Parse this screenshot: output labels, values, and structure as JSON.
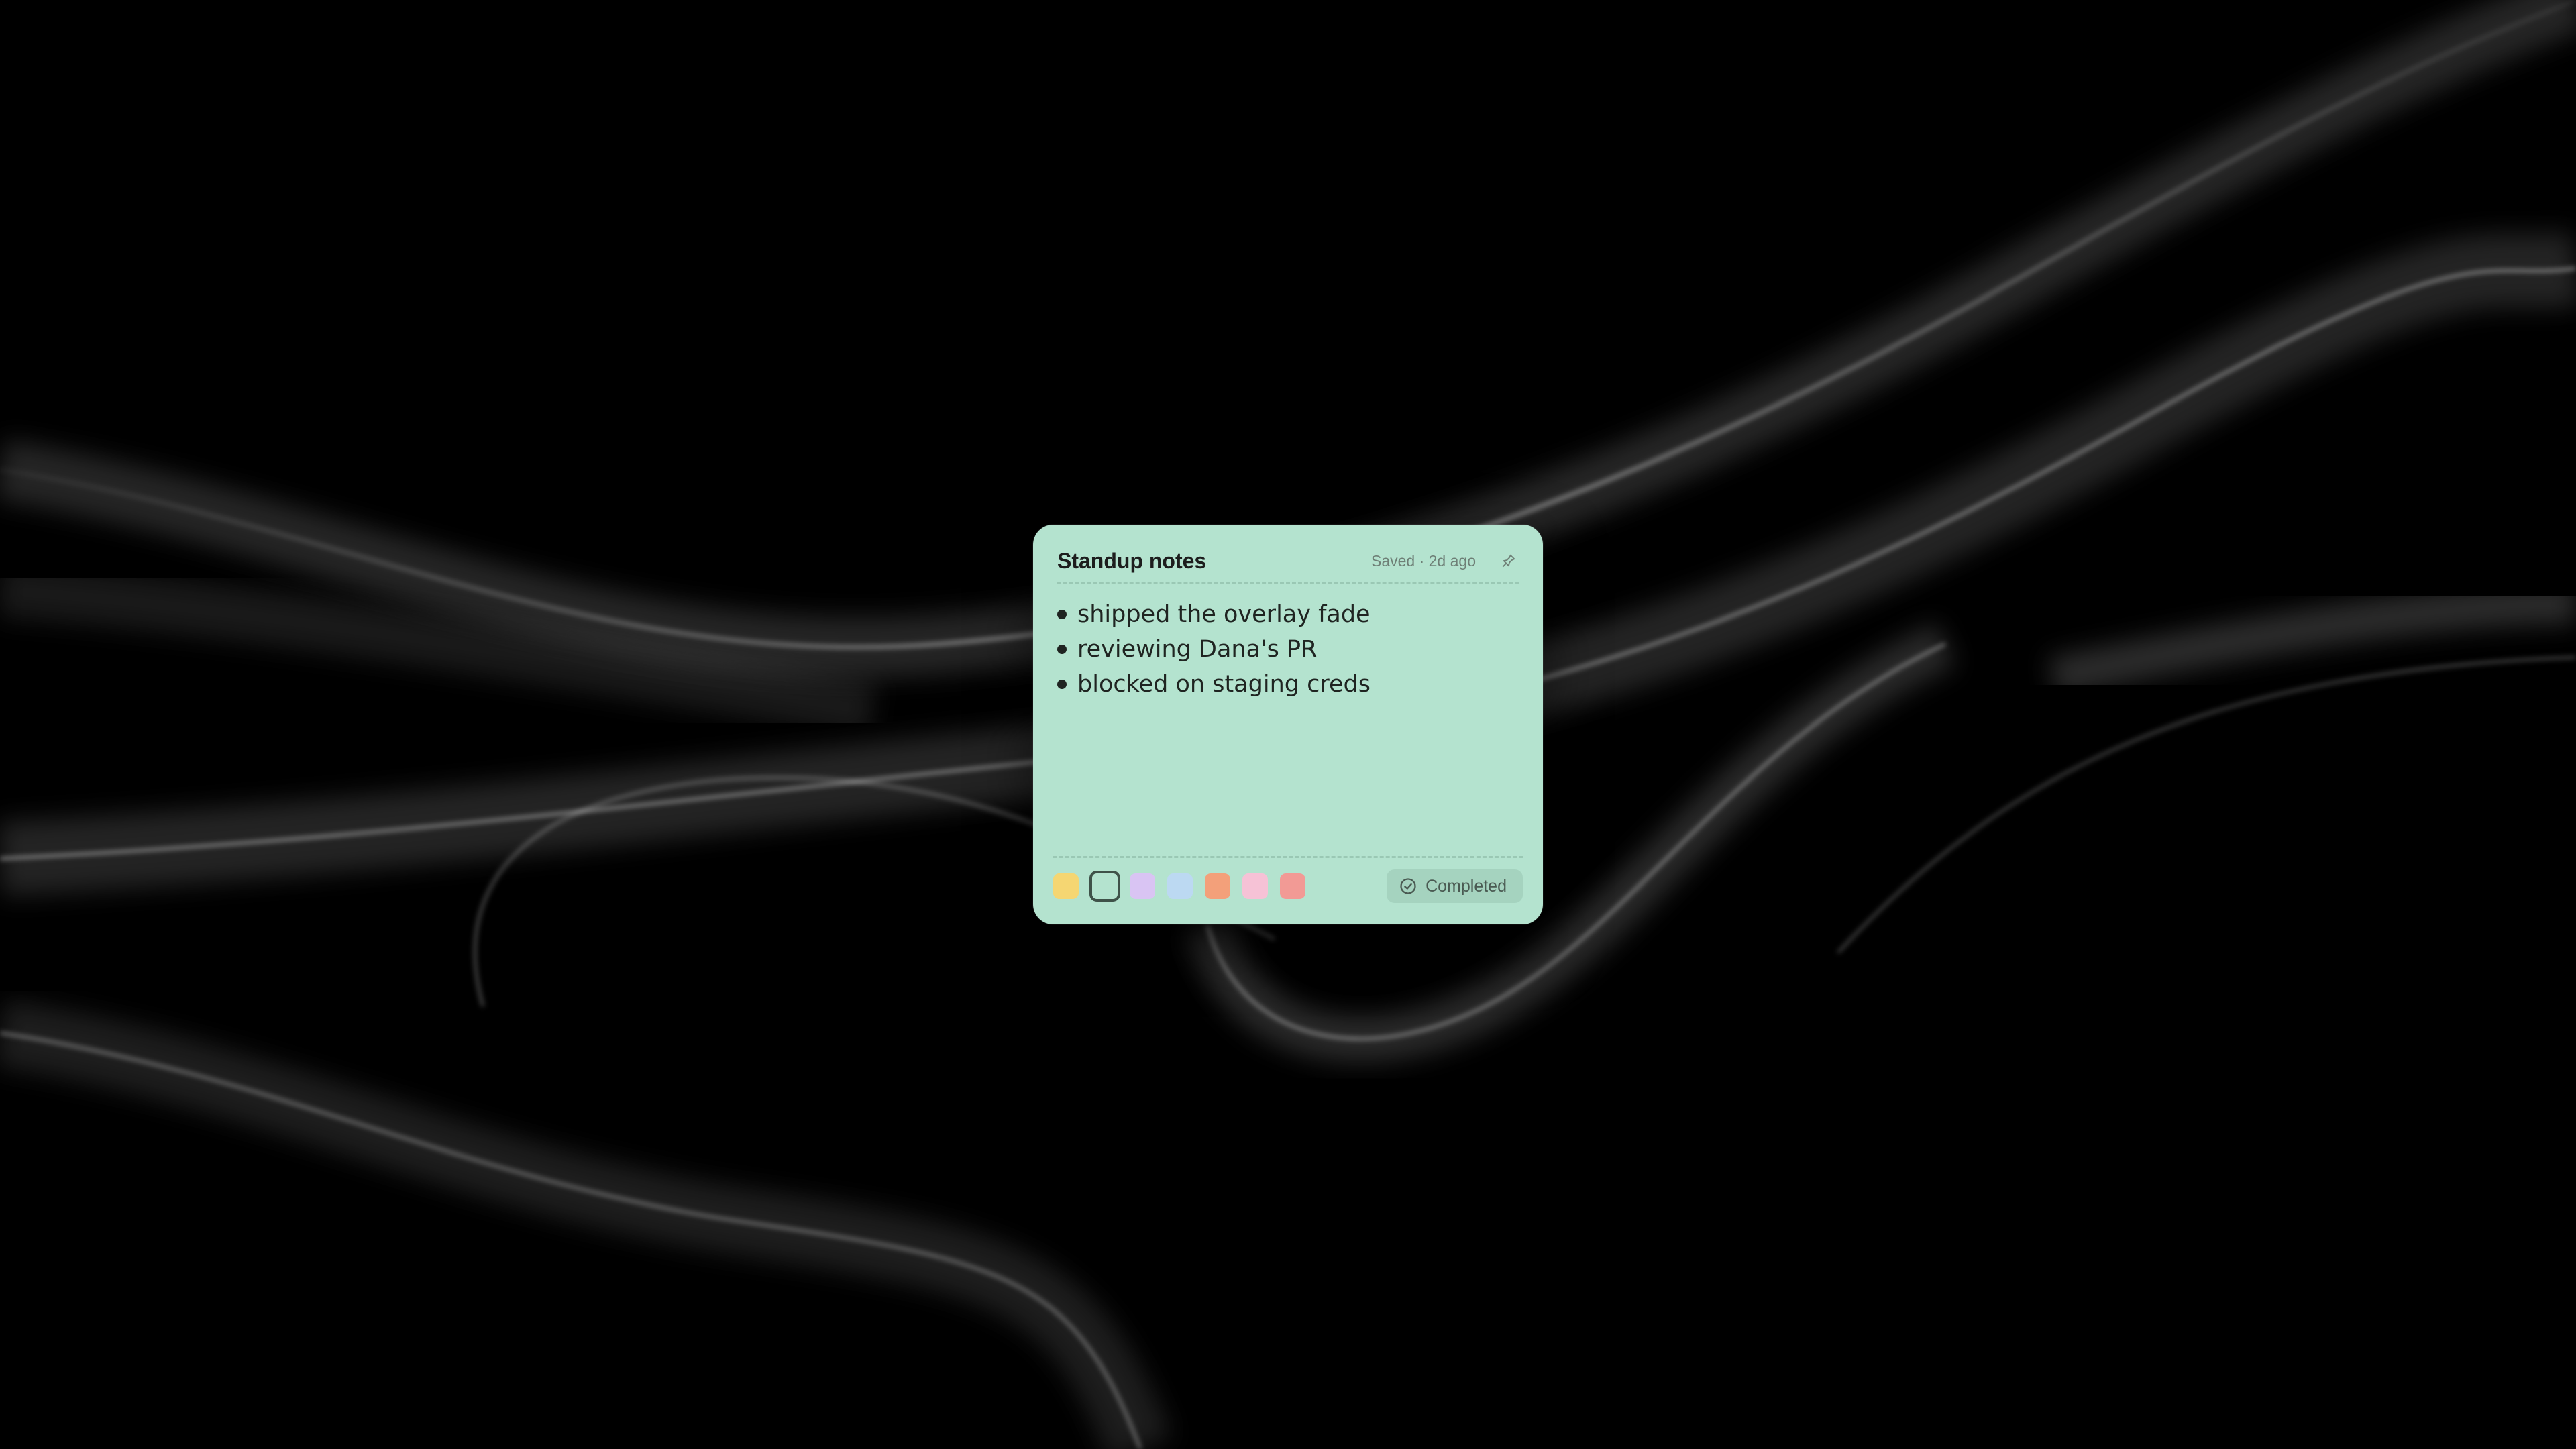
{
  "note": {
    "title": "Standup notes",
    "status": "Saved · 2d ago",
    "background": "#b4e3cf",
    "items": [
      "shipped the overlay fade",
      "reviewing Dana's PR",
      "blocked on staging creds"
    ],
    "colors": {
      "options": [
        {
          "name": "yellow",
          "hex": "#f5d672"
        },
        {
          "name": "mint",
          "hex": "#b4e3cf",
          "selected": true
        },
        {
          "name": "lavender",
          "hex": "#d9c4f3"
        },
        {
          "name": "blue",
          "hex": "#bcd9f2"
        },
        {
          "name": "orange",
          "hex": "#f3a07a"
        },
        {
          "name": "pink",
          "hex": "#f6c2d6"
        },
        {
          "name": "red",
          "hex": "#f29a95"
        }
      ]
    },
    "complete_label": "Completed",
    "icons": {
      "pin": "pin-icon",
      "complete": "check-circle-icon"
    }
  }
}
